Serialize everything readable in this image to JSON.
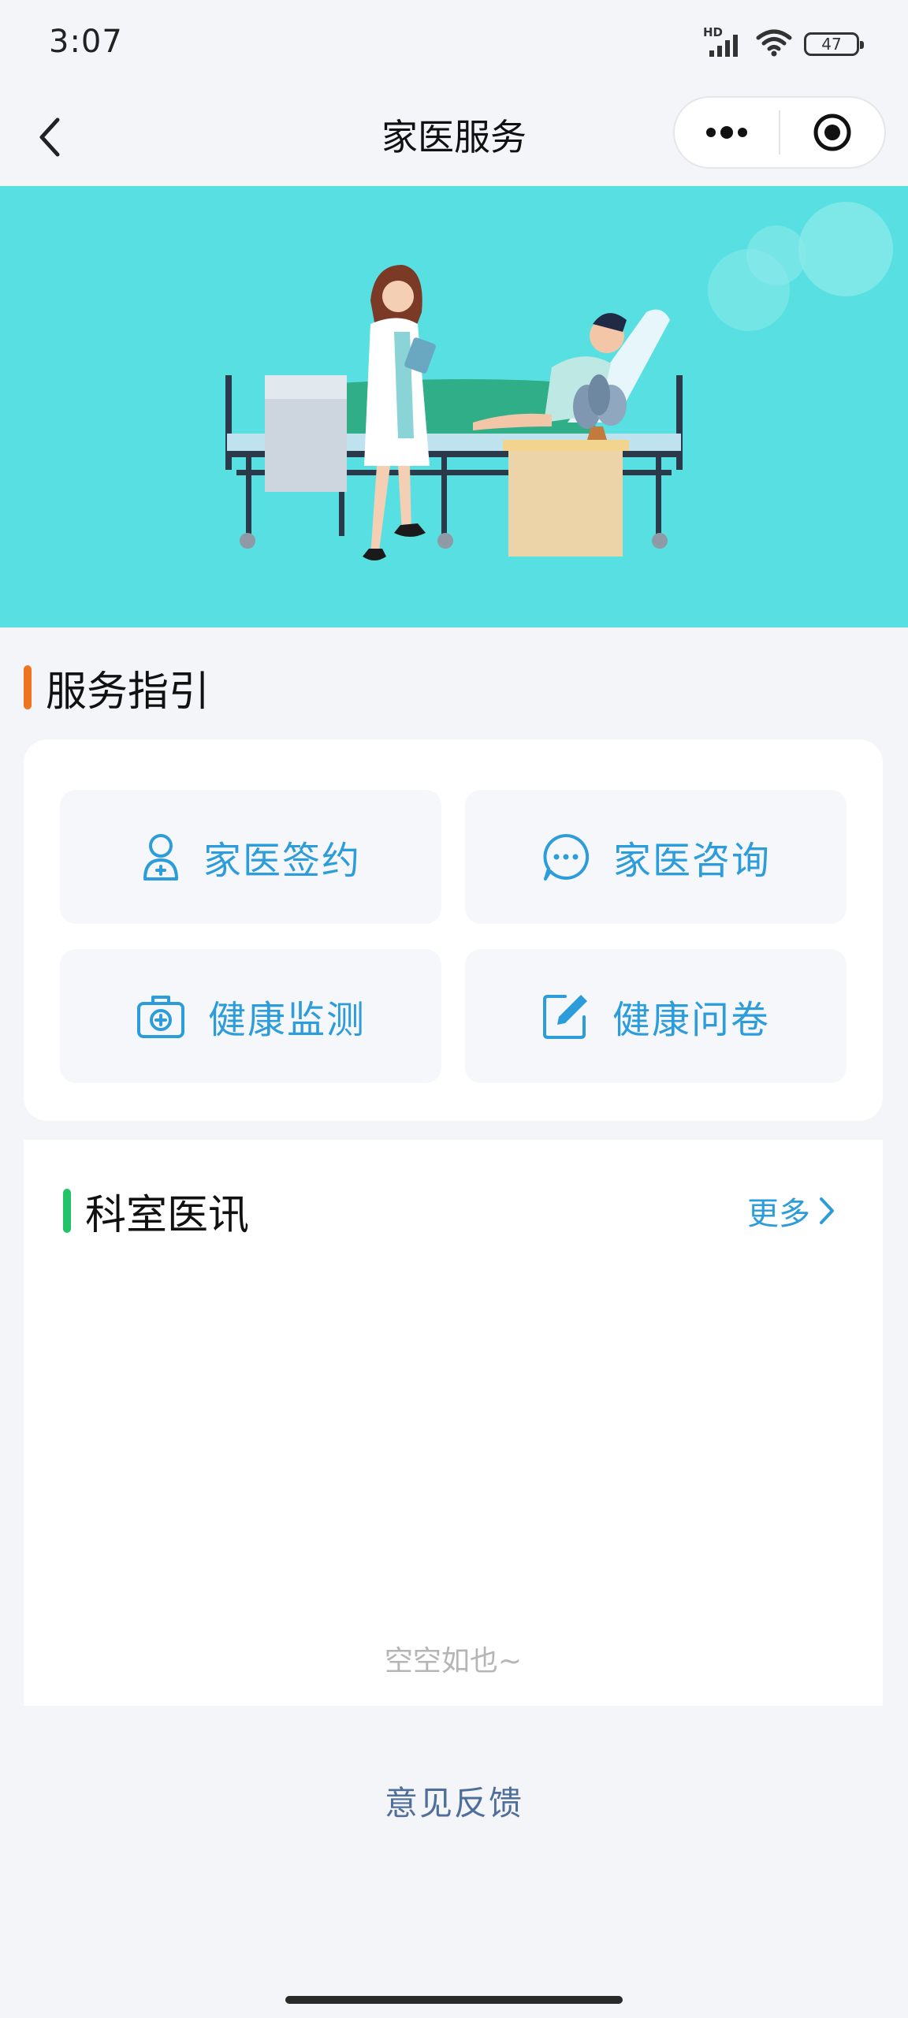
{
  "status_bar": {
    "time": "3:07",
    "network_label": "HD",
    "battery_level": "47"
  },
  "nav": {
    "title": "家医服务",
    "back_icon": "chevron-left-icon",
    "menu_icon": "more-dots-icon",
    "close_icon": "target-circle-icon"
  },
  "banner": {
    "illustration": "doctor-visiting-patient-illustration",
    "background_color": "#57dfe1"
  },
  "service_section": {
    "title": "服务指引",
    "accent_color": "#f0731f",
    "items": [
      {
        "label": "家医签约",
        "icon": "doctor-person-icon"
      },
      {
        "label": "家医咨询",
        "icon": "chat-bubble-icon"
      },
      {
        "label": "健康监测",
        "icon": "medical-kit-icon"
      },
      {
        "label": "健康问卷",
        "icon": "edit-form-icon"
      }
    ]
  },
  "news_section": {
    "title": "科室医讯",
    "accent_color": "#22c36b",
    "more_label": "更多",
    "empty_text": "空空如也~"
  },
  "footer": {
    "feedback_label": "意见反馈"
  },
  "colors": {
    "primary_blue": "#2d9cdb",
    "page_background": "#f4f5f9"
  }
}
